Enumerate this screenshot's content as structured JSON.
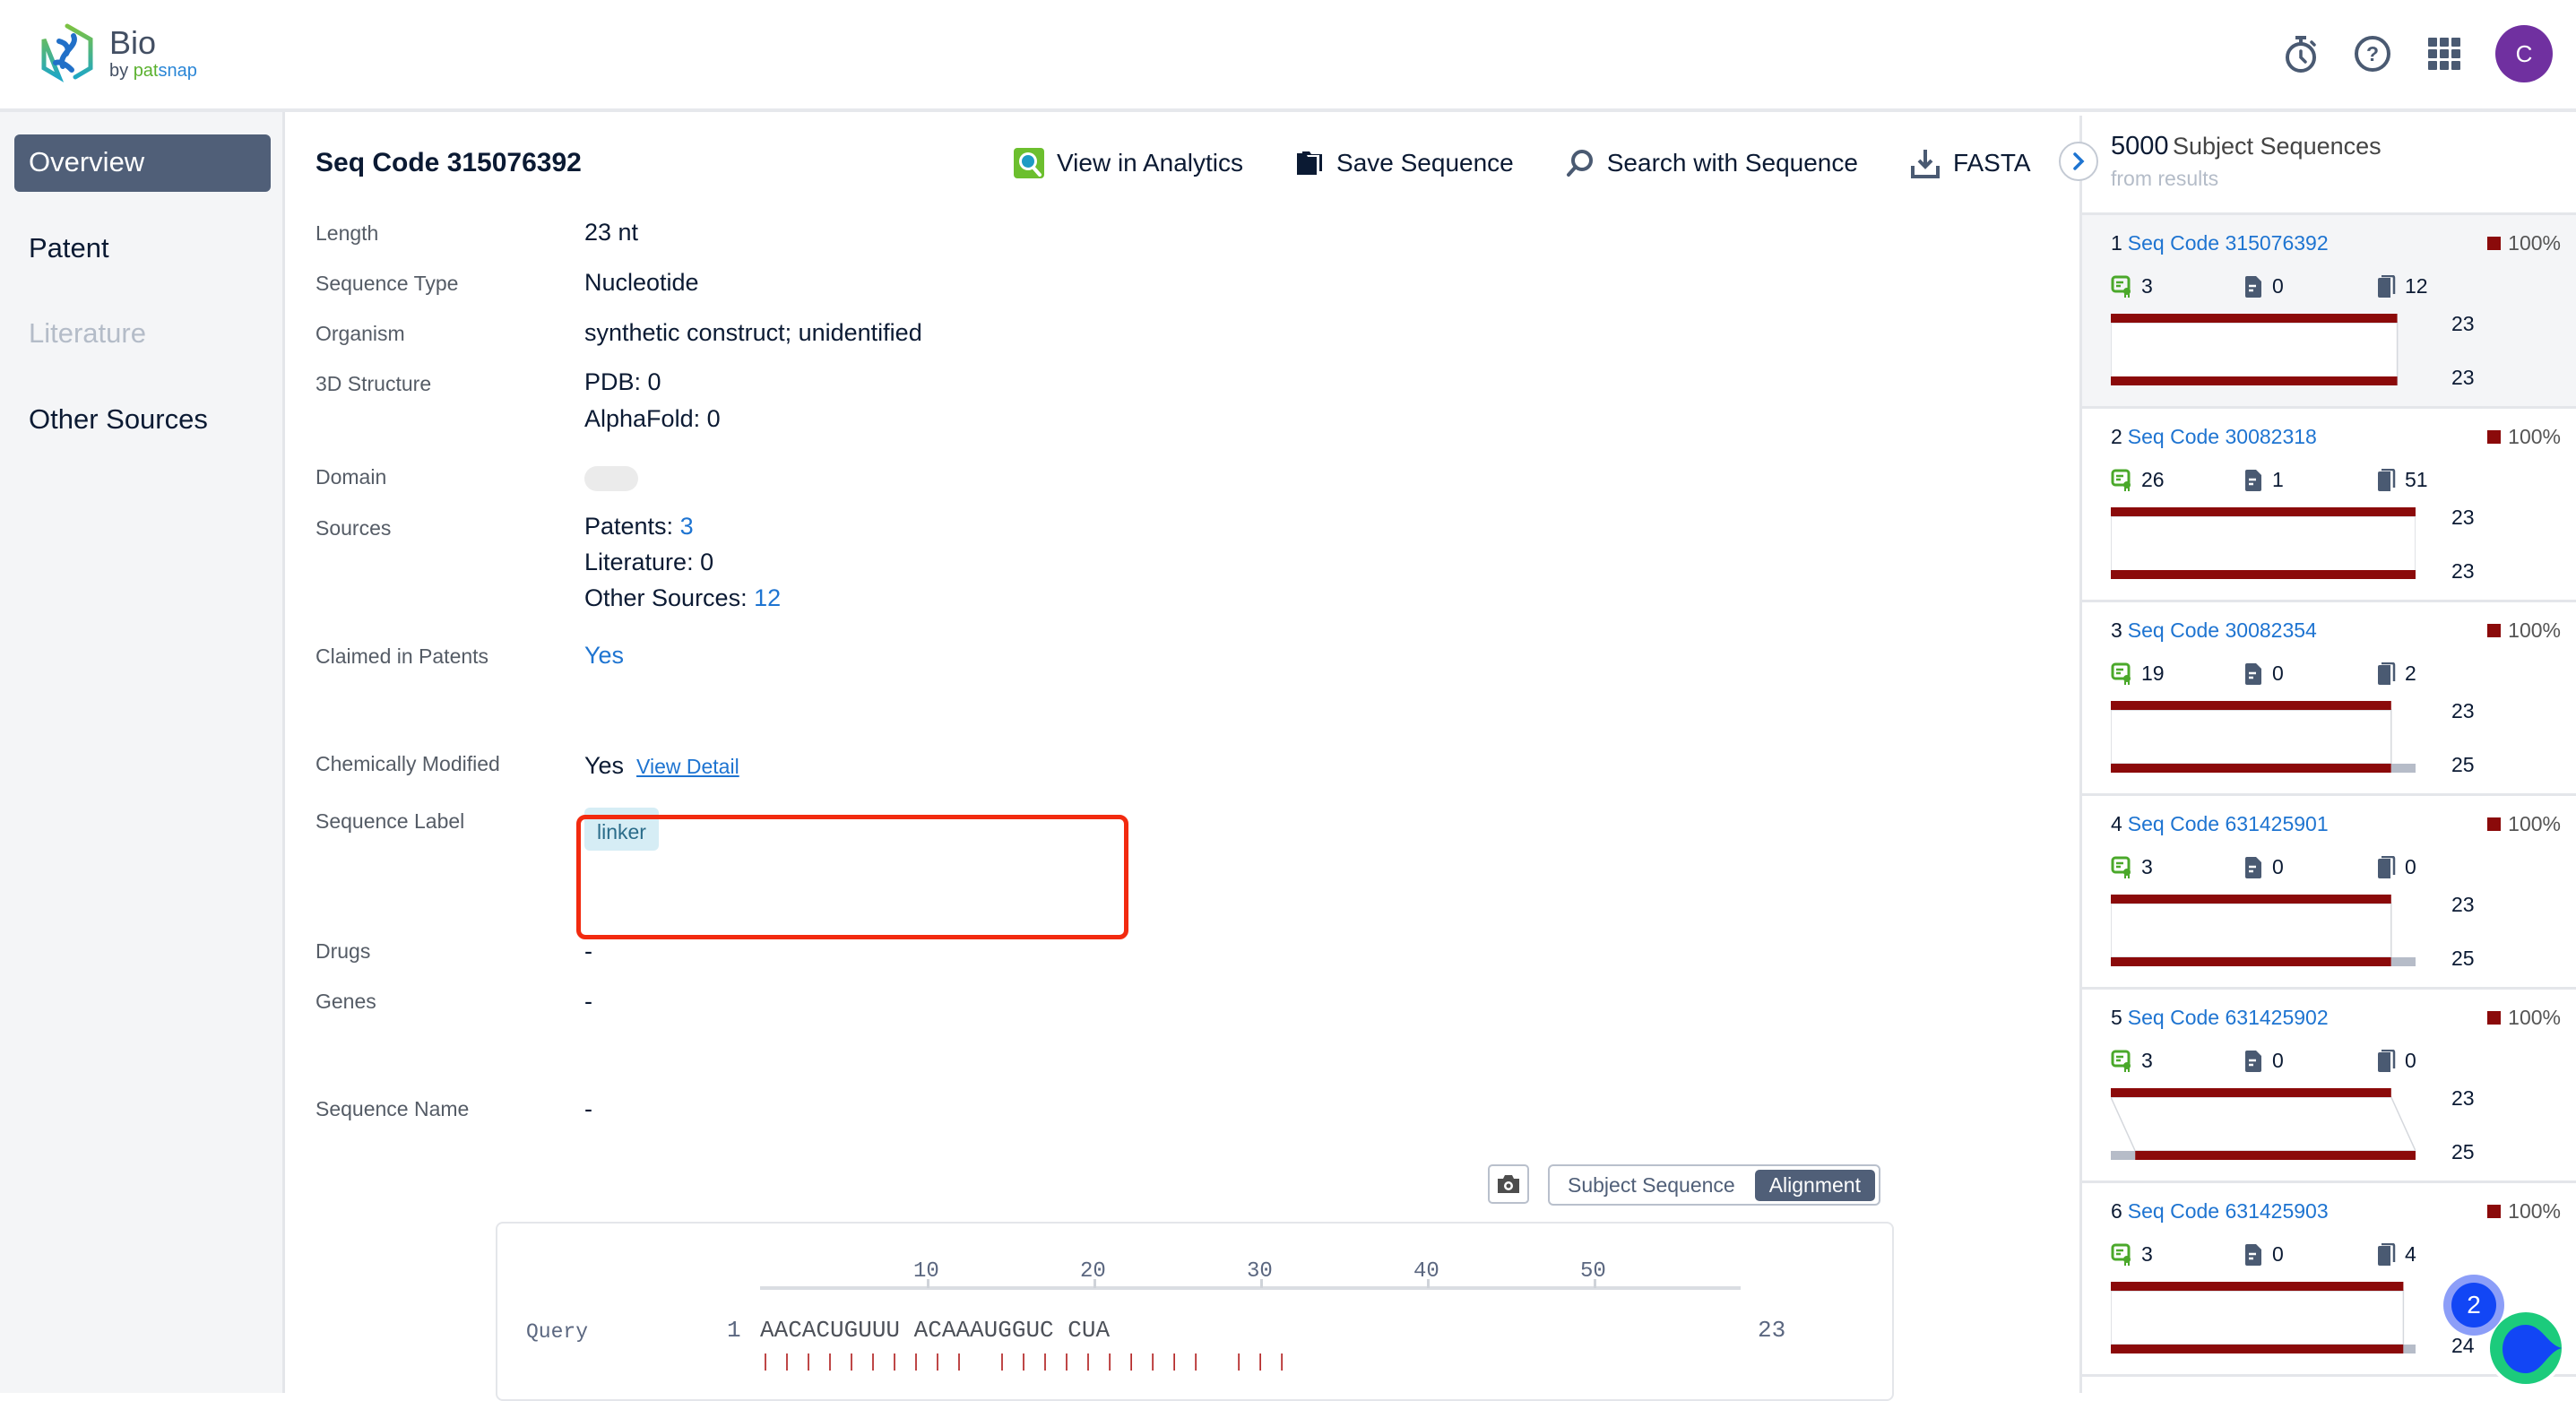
{
  "header": {
    "brand_title": "Bio",
    "brand_by": "by ",
    "brand_pat": "pat",
    "brand_snap": "snap",
    "icons": [
      "timer-icon",
      "help-icon",
      "apps-grid-icon"
    ],
    "avatar_initial": "C"
  },
  "sidebar": {
    "items": [
      {
        "label": "Overview",
        "state": "active"
      },
      {
        "label": "Patent",
        "state": "normal"
      },
      {
        "label": "Literature",
        "state": "disabled"
      },
      {
        "label": "Other Sources",
        "state": "normal"
      }
    ]
  },
  "main": {
    "title": "Seq Code 315076392",
    "actions": [
      {
        "label": "View in Analytics",
        "icon": "analytics-icon"
      },
      {
        "label": "Save Sequence",
        "icon": "folder-icon"
      },
      {
        "label": "Search with Sequence",
        "icon": "search-icon"
      },
      {
        "label": "FASTA",
        "icon": "download-icon"
      }
    ],
    "fields": {
      "length": {
        "label": "Length",
        "value": "23 nt"
      },
      "sequence_type": {
        "label": "Sequence Type",
        "value": "Nucleotide"
      },
      "organism": {
        "label": "Organism",
        "value": "synthetic construct; unidentified"
      },
      "structure": {
        "label": "3D Structure",
        "pdb": "PDB: 0",
        "alphafold": "AlphaFold: 0"
      },
      "domain": {
        "label": "Domain"
      },
      "sources": {
        "label": "Sources",
        "patents_label": "Patents: ",
        "patents_count": "3",
        "literature": "Literature: 0",
        "other_label": "Other Sources: ",
        "other_count": "12"
      },
      "claimed": {
        "label": "Claimed in Patents",
        "value": "Yes"
      },
      "chem_mod": {
        "label": "Chemically Modified",
        "value": "Yes",
        "link": "View Detail"
      },
      "seq_label": {
        "label": "Sequence Label",
        "tag": "linker"
      },
      "drugs": {
        "label": "Drugs",
        "value": "-"
      },
      "genes": {
        "label": "Genes",
        "value": "-"
      },
      "seq_name": {
        "label": "Sequence Name",
        "value": "-"
      }
    },
    "view_toggle": {
      "options": [
        "Subject Sequence",
        "Alignment"
      ],
      "selected": "Alignment"
    },
    "alignment": {
      "ruler_ticks": [
        "10",
        "20",
        "30",
        "40",
        "50"
      ],
      "query_label": "Query",
      "query_start": "1",
      "query_seq": "AACACUGUUU ACAAAUGGUC CUA",
      "query_end": "23",
      "match_line": "| | | | | | | | | |   | | | | | | | | | |   | | |"
    }
  },
  "right_panel": {
    "count": "5000",
    "title": "Subject Sequences",
    "subtitle": "from results",
    "items": [
      {
        "index": "1",
        "code": "Seq Code 315076392",
        "identity": "100%",
        "patents": "3",
        "literature": "0",
        "other": "12",
        "query_len": "23",
        "subject_len": "23",
        "selected": true
      },
      {
        "index": "2",
        "code": "Seq Code 30082318",
        "identity": "100%",
        "patents": "26",
        "literature": "1",
        "other": "51",
        "query_len": "23",
        "subject_len": "23",
        "selected": false
      },
      {
        "index": "3",
        "code": "Seq Code 30082354",
        "identity": "100%",
        "patents": "19",
        "literature": "0",
        "other": "2",
        "query_len": "23",
        "subject_len": "25",
        "selected": false
      },
      {
        "index": "4",
        "code": "Seq Code 631425901",
        "identity": "100%",
        "patents": "3",
        "literature": "0",
        "other": "0",
        "query_len": "23",
        "subject_len": "25",
        "selected": false
      },
      {
        "index": "5",
        "code": "Seq Code 631425902",
        "identity": "100%",
        "patents": "3",
        "literature": "0",
        "other": "0",
        "query_len": "23",
        "subject_len": "25",
        "selected": false
      },
      {
        "index": "6",
        "code": "Seq Code 631425903",
        "identity": "100%",
        "patents": "3",
        "literature": "0",
        "other": "4",
        "query_len": "23",
        "subject_len": "24",
        "selected": false
      }
    ]
  },
  "chat_fab": {
    "badge": "2"
  },
  "colors": {
    "accent": "#1e74d1",
    "nav_active": "#505f78",
    "match": "#8b0a0a",
    "highlight": "#f22a0f",
    "avatar": "#7030a0"
  }
}
